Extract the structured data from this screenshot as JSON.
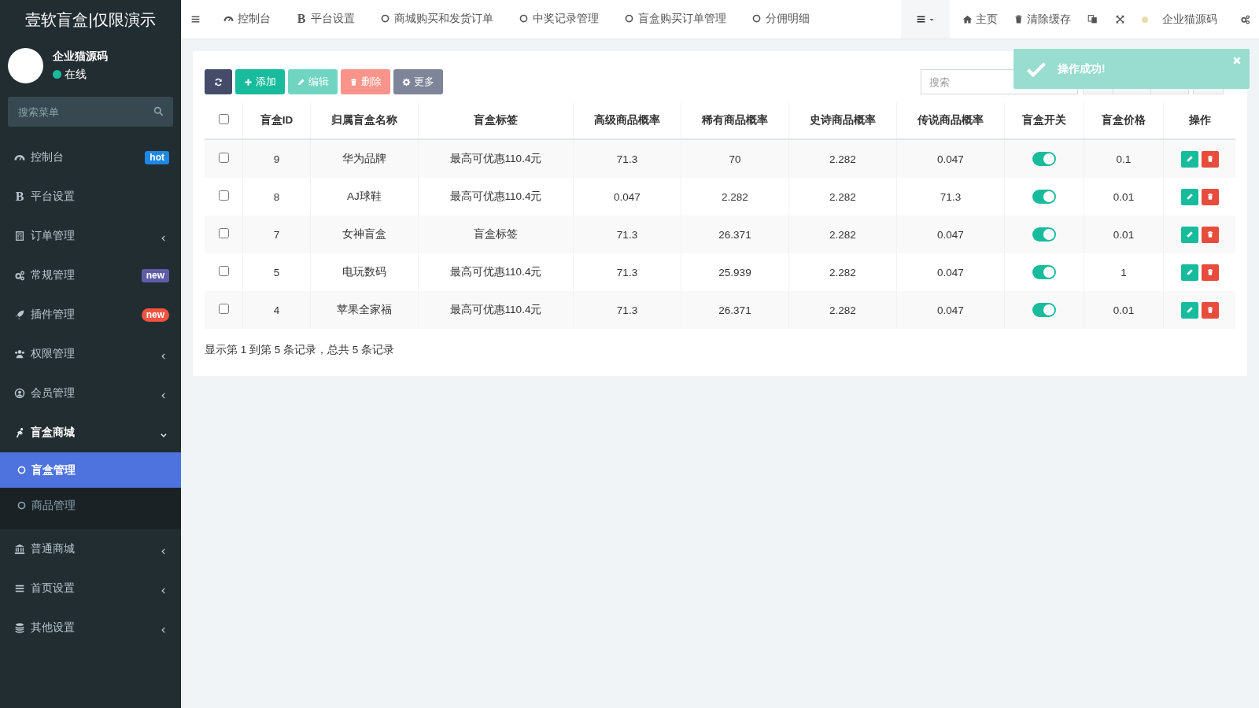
{
  "sidebar": {
    "logo": "壹软盲盒|仅限演示",
    "user": {
      "name": "企业猫源码",
      "status": "在线"
    },
    "search": {
      "placeholder": "搜索菜单"
    },
    "menu": [
      {
        "label": "控制台",
        "selected": false,
        "badge": {
          "text": "hot",
          "color": "#1e88e5",
          "kind": "square"
        }
      },
      {
        "label": "平台设置",
        "glyph": "B",
        "selected": false
      },
      {
        "label": "订单管理",
        "selected": false,
        "expanded": false
      },
      {
        "label": "常规管理",
        "selected": false,
        "badge": {
          "text": "new",
          "color": "#605ca8",
          "kind": "square"
        }
      },
      {
        "label": "插件管理",
        "selected": false,
        "badge": {
          "text": "new",
          "color": "#f0533f",
          "kind": "pill"
        }
      },
      {
        "label": "权限管理",
        "selected": false,
        "expanded": false
      },
      {
        "label": "会员管理",
        "selected": false,
        "expanded": false
      },
      {
        "label": "盲盒商城",
        "selected": true,
        "expanded": true,
        "children": [
          {
            "label": "盲盒管理",
            "selected": true
          },
          {
            "label": "商品管理",
            "selected": false
          }
        ]
      },
      {
        "label": "普通商城",
        "selected": false,
        "expanded": false
      },
      {
        "label": "首页设置",
        "selected": false,
        "expanded": false
      },
      {
        "label": "其他设置",
        "selected": false,
        "expanded": false
      }
    ]
  },
  "header": {
    "tabs": [
      {
        "label": "控制台",
        "selected": false
      },
      {
        "label": "平台设置",
        "glyph": "B",
        "selected": false
      },
      {
        "label": "商城购买和发货订单",
        "selected": false
      },
      {
        "label": "中奖记录管理",
        "selected": false
      },
      {
        "label": "盲盒购买订单管理",
        "selected": false
      },
      {
        "label": "分佣明细",
        "selected": false
      }
    ],
    "home": "主页",
    "clear_cache": "清除缓存",
    "user_name": "企业猫源码"
  },
  "toolbar": {
    "buttons": [
      {
        "kind": "refresh",
        "disabled": false
      },
      {
        "kind": "add",
        "label": "添加",
        "disabled": false
      },
      {
        "kind": "edit",
        "label": "编辑",
        "disabled": true
      },
      {
        "kind": "delete",
        "label": "删除",
        "disabled": true
      },
      {
        "kind": "more",
        "label": "更多",
        "disabled": false
      }
    ],
    "search": {
      "placeholder": "搜索"
    }
  },
  "table": {
    "select_all_checked": false,
    "columns": [
      "盲盒ID",
      "归属盲盒名称",
      "盲盒标签",
      "高级商品概率",
      "稀有商品概率",
      "史诗商品概率",
      "传说商品概率",
      "盲盒开关",
      "盲盒价格",
      "操作"
    ],
    "rows": [
      {
        "checked": false,
        "id": "9",
        "name": "华为品牌",
        "tag": "最高可优惠110.4元",
        "advanced": "71.3",
        "rare": "70",
        "epic": "2.282",
        "legendary": "0.047",
        "enabled": true,
        "price": "0.1"
      },
      {
        "checked": false,
        "id": "8",
        "name": "AJ球鞋",
        "tag": "最高可优惠110.4元",
        "advanced": "0.047",
        "rare": "2.282",
        "epic": "2.282",
        "legendary": "71.3",
        "enabled": true,
        "price": "0.01"
      },
      {
        "checked": false,
        "id": "7",
        "name": "女神盲盒",
        "tag": "盲盒标签",
        "advanced": "71.3",
        "rare": "26.371",
        "epic": "2.282",
        "legendary": "0.047",
        "enabled": true,
        "price": "0.01"
      },
      {
        "checked": false,
        "id": "5",
        "name": "电玩数码",
        "tag": "最高可优惠110.4元",
        "advanced": "71.3",
        "rare": "25.939",
        "epic": "2.282",
        "legendary": "0.047",
        "enabled": true,
        "price": "1"
      },
      {
        "checked": false,
        "id": "4",
        "name": "苹果全家福",
        "tag": "最高可优惠110.4元",
        "advanced": "71.3",
        "rare": "26.371",
        "epic": "2.282",
        "legendary": "0.047",
        "enabled": true,
        "price": "0.01"
      }
    ],
    "summary": "显示第 1 到第 5 条记录，总共 5 条记录"
  },
  "toast": {
    "message": "操作成功!"
  }
}
